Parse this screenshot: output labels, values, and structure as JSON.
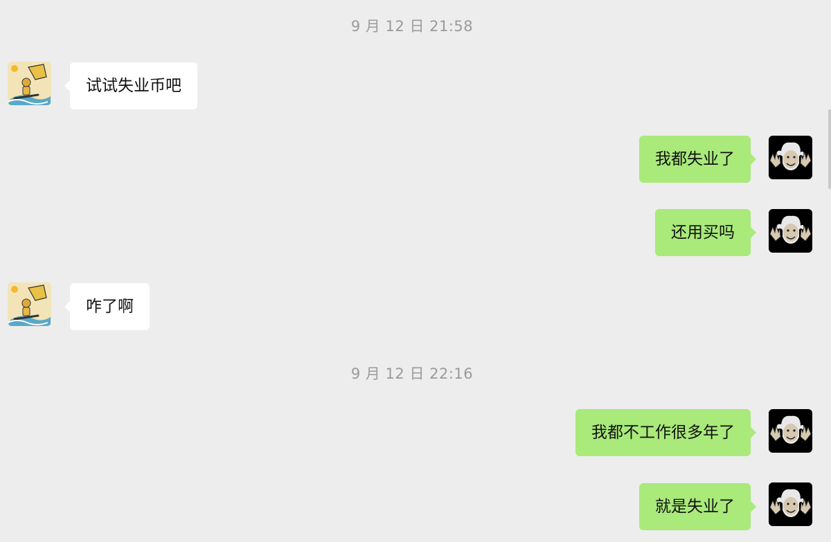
{
  "chat": {
    "timestamps": [
      {
        "text": "9 月 12 日 21:58"
      },
      {
        "text": "9 月 12 日 22:16"
      }
    ],
    "messages": [
      {
        "sender": "other",
        "text": "试试失业币吧",
        "avatar": "surfer-avatar"
      },
      {
        "sender": "self",
        "text": "我都失业了",
        "avatar": "einstein-avatar"
      },
      {
        "sender": "self",
        "text": "还用买吗",
        "avatar": "einstein-avatar"
      },
      {
        "sender": "other",
        "text": "咋了啊",
        "avatar": "surfer-avatar"
      },
      {
        "sender": "self",
        "text": "我都不工作很多年了",
        "avatar": "einstein-avatar"
      },
      {
        "sender": "self",
        "text": "就是失业了",
        "avatar": "einstein-avatar"
      }
    ]
  },
  "colors": {
    "background": "#ededed",
    "bubble_self": "#a9ea7a",
    "bubble_other": "#ffffff",
    "timestamp": "#9a9a9a"
  }
}
